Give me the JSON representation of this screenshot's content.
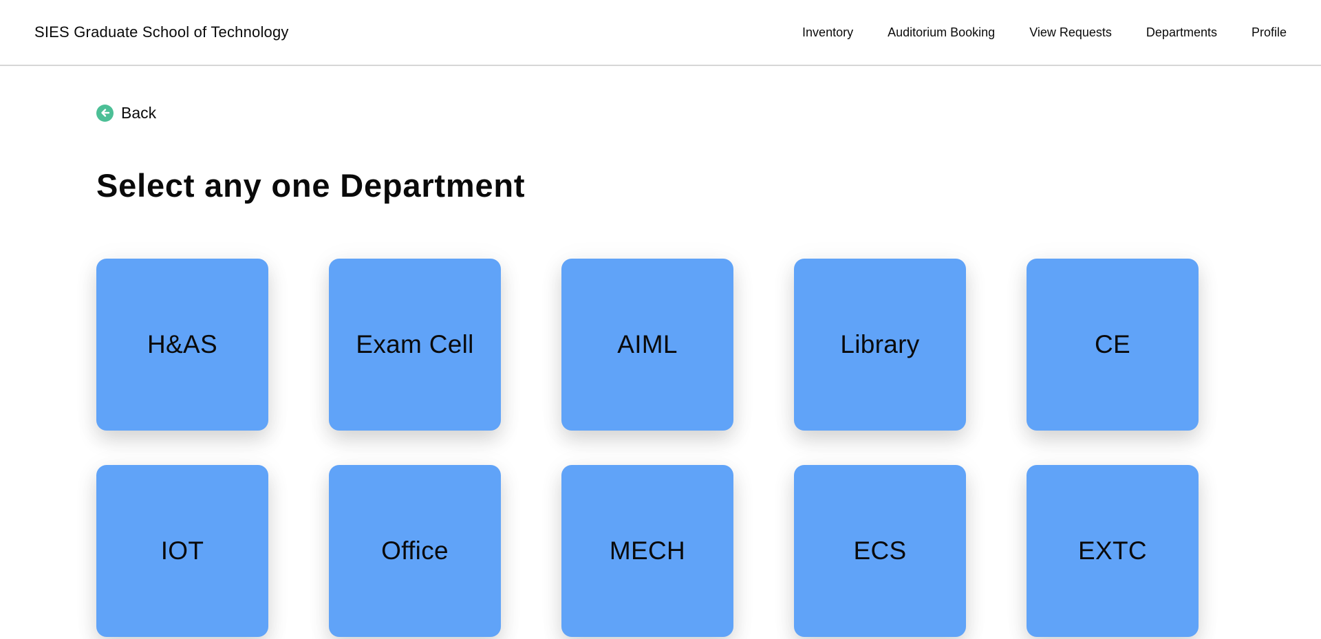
{
  "header": {
    "brand": "SIES Graduate School of Technology",
    "nav": [
      {
        "label": "Inventory"
      },
      {
        "label": "Auditorium Booking"
      },
      {
        "label": "View Requests"
      },
      {
        "label": "Departments"
      },
      {
        "label": "Profile"
      }
    ]
  },
  "back": {
    "label": "Back",
    "icon": "arrow-left-circle-icon",
    "icon_color": "#4cbf96"
  },
  "main": {
    "title": "Select any one Department",
    "card_color": "#60a3f8",
    "departments": [
      {
        "label": "H&AS"
      },
      {
        "label": "Exam Cell"
      },
      {
        "label": "AIML"
      },
      {
        "label": "Library"
      },
      {
        "label": "CE"
      },
      {
        "label": "IOT"
      },
      {
        "label": "Office"
      },
      {
        "label": "MECH"
      },
      {
        "label": "ECS"
      },
      {
        "label": "EXTC"
      }
    ]
  }
}
